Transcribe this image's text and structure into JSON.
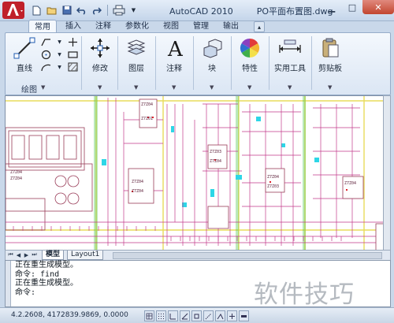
{
  "window": {
    "app_name": "AutoCAD 2010",
    "file_name": "PO平面布置图.dwg",
    "controls": [
      "minimize-icon",
      "maximize-icon",
      "close-icon"
    ]
  },
  "quick_access": [
    "new-icon",
    "open-icon",
    "save-icon",
    "undo-icon",
    "redo-icon",
    "print-icon"
  ],
  "ribbon": {
    "tabs": [
      {
        "label": "常用",
        "active": true
      },
      {
        "label": "插入",
        "active": false
      },
      {
        "label": "注释",
        "active": false
      },
      {
        "label": "参数化",
        "active": false
      },
      {
        "label": "视图",
        "active": false
      },
      {
        "label": "管理",
        "active": false
      },
      {
        "label": "输出",
        "active": false
      }
    ],
    "draw_panel_title": "绘图",
    "tools": {
      "line": "直线",
      "modify": "修改",
      "layers": "图层",
      "annotation": "注释",
      "block": "块",
      "properties": "特性",
      "utilities": "实用工具",
      "clipboard": "剪贴板"
    }
  },
  "drawing": {
    "labels": [
      "Z7Z04",
      "Z7Z01",
      "Z7Z04",
      "Z7Z04",
      "Z7Z03",
      "Z7Z04",
      "Z7Z04",
      "Z7Z03",
      "Z7Z04",
      "Z7Z04",
      "Z7Z04"
    ]
  },
  "layout_tabs": [
    {
      "label": "模型",
      "active": true
    },
    {
      "label": "Layout1",
      "active": false
    }
  ],
  "command": {
    "lines": [
      "正在重生成模型。",
      "命令: find",
      "正在重生成模型。",
      "命令:"
    ]
  },
  "status": {
    "coordinates": "4.2.2608, 4172839.9869, 0.0000"
  },
  "watermark": "软件技巧",
  "colors": {
    "accent_red": "#d2262a",
    "ribbon_bg": "#dbe6f4",
    "canvas_bg": "#ffffff"
  }
}
